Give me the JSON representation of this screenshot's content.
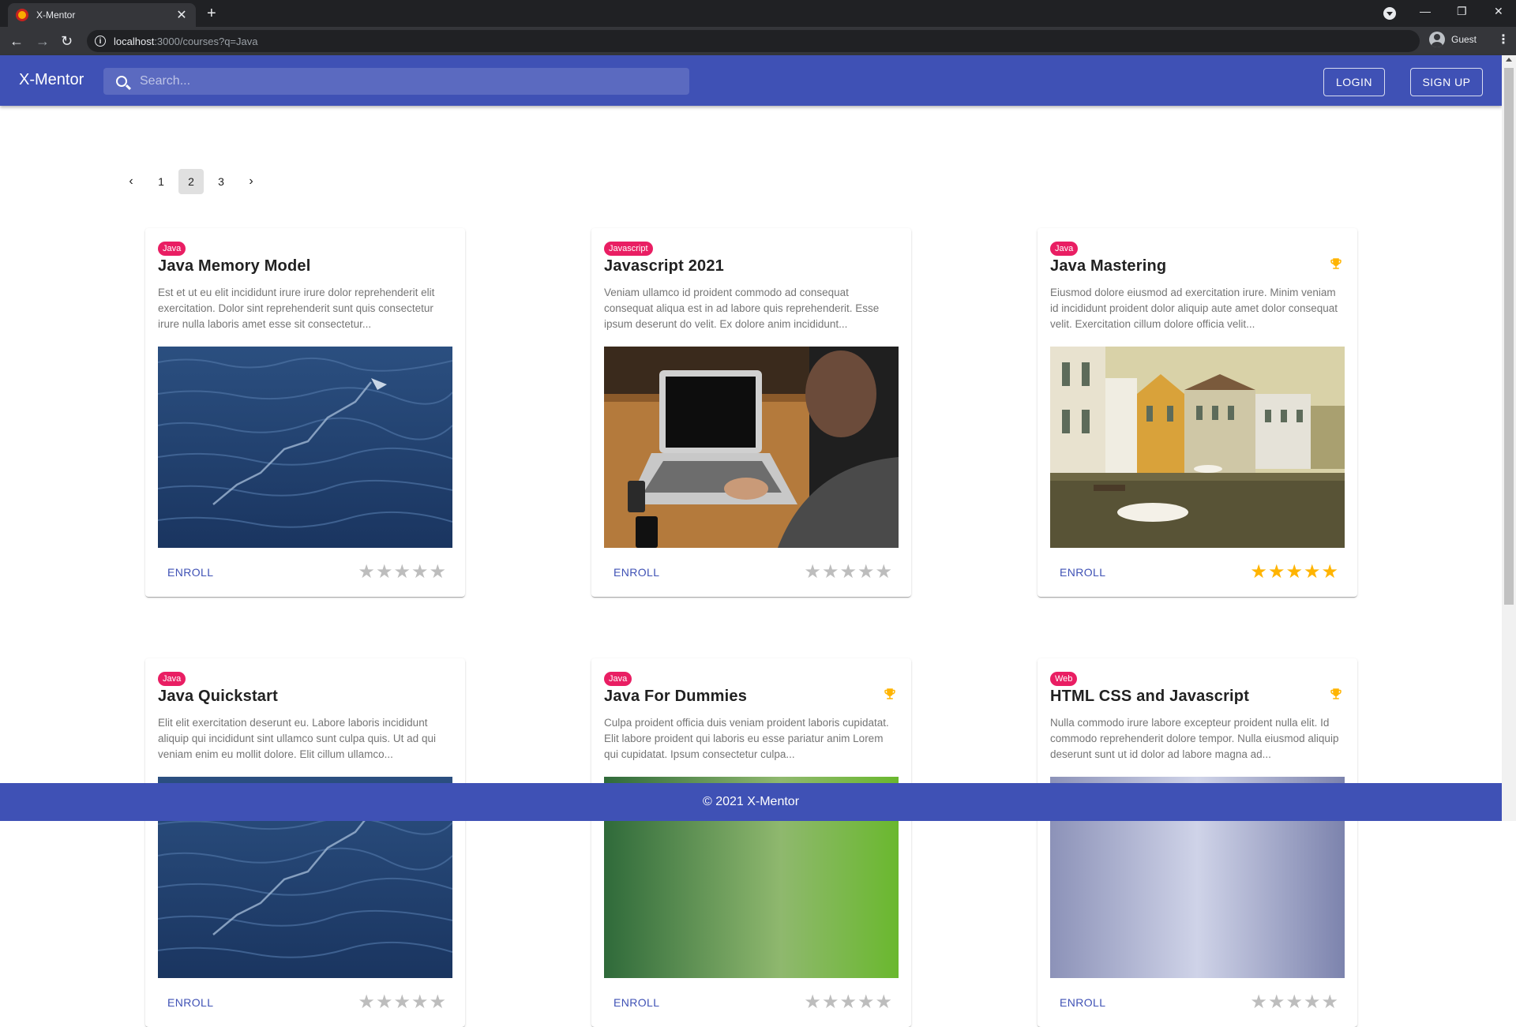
{
  "browser": {
    "tab_title": "X-Mentor",
    "tab_close": "✕",
    "new_tab": "+",
    "url_host": "localhost",
    "url_rest": ":3000/courses?q=Java",
    "profile_label": "Guest",
    "back": "←",
    "forward": "→",
    "reload": "↻",
    "minimize": "—",
    "restore": "❐",
    "close": "✕",
    "menu": "⋮"
  },
  "app": {
    "brand": "X-Mentor",
    "search_placeholder": "Search...",
    "login_label": "LOGIN",
    "signup_label": "SIGN UP",
    "footer": "© 2021 X-Mentor"
  },
  "pagination": {
    "prev": "‹",
    "next": "›",
    "pages": [
      "1",
      "2",
      "3"
    ],
    "current": "2"
  },
  "colors": {
    "primary": "#3f51b5",
    "chip": "#e91e63",
    "star_filled": "#ffb400",
    "star_empty": "#bdbdbd"
  },
  "courses": [
    {
      "tag": "Java",
      "title": "Java Memory Model",
      "description": "Est et ut eu elit incididunt irure irure dolor reprehenderit elit exercitation. Dolor sint reprehenderit sunt quis consectetur irure nulla laboris amet esse sit consectetur...",
      "trophy": false,
      "image": "ocean-water",
      "enroll_label": "ENROLL",
      "rating": 0
    },
    {
      "tag": "Javascript",
      "title": "Javascript 2021",
      "description": "Veniam ullamco id proident commodo ad consequat consequat aliqua est in ad labore quis reprehenderit. Esse ipsum deserunt do velit. Ex dolore anim incididunt...",
      "trophy": false,
      "image": "laptop-typing",
      "enroll_label": "ENROLL",
      "rating": 0
    },
    {
      "tag": "Java",
      "title": "Java Mastering",
      "description": "Eiusmod dolore eiusmod ad exercitation irure. Minim veniam id incididunt proident dolor aliquip aute amet dolor consequat velit. Exercitation cillum dolore officia velit...",
      "trophy": true,
      "image": "canal-houses",
      "enroll_label": "ENROLL",
      "rating": 5
    },
    {
      "tag": "Java",
      "title": "Java Quickstart",
      "description": "Elit elit exercitation deserunt eu. Labore laboris incididunt aliquip qui incididunt sint ullamco sunt culpa quis. Ut ad qui veniam enim eu mollit dolore. Elit cillum ullamco...",
      "trophy": false,
      "image": "ocean-water",
      "enroll_label": "ENROLL",
      "rating": 0
    },
    {
      "tag": "Java",
      "title": "Java For Dummies",
      "description": "Culpa proident officia duis veniam proident laboris cupidatat. Elit labore proident qui laboris eu esse pariatur anim Lorem qui cupidatat. Ipsum consectetur culpa...",
      "trophy": true,
      "image": "green-nature",
      "enroll_label": "ENROLL",
      "rating": 0
    },
    {
      "tag": "Web",
      "title": "HTML CSS and Javascript",
      "description": "Nulla commodo irure labore excepteur proident nulla elit. Id commodo reprehenderit dolore tempor. Nulla eiusmod aliquip deserunt sunt ut id dolor ad labore magna ad...",
      "trophy": true,
      "image": "sky-light",
      "enroll_label": "ENROLL",
      "rating": 0
    }
  ]
}
